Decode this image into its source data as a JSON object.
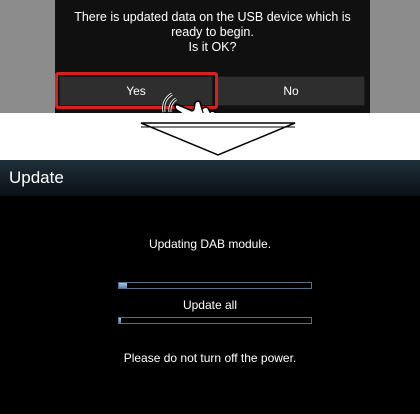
{
  "dialog": {
    "message_lines": [
      "There is updated data on the USB device which is",
      "ready to begin.",
      "Is it OK?"
    ],
    "yes_label": "Yes",
    "no_label": "No"
  },
  "update_screen": {
    "title": "Update",
    "dab_label": "Updating DAB module.",
    "dab_progress_percent": 4,
    "all_label": "Update all",
    "all_progress_percent": 1,
    "notice": "Please do not turn off the power."
  },
  "colors": {
    "highlight": "#d6201f",
    "progress_fill": "#8fb2dc"
  },
  "icons": [
    "hand-pointer-icon",
    "down-arrow-icon"
  ]
}
